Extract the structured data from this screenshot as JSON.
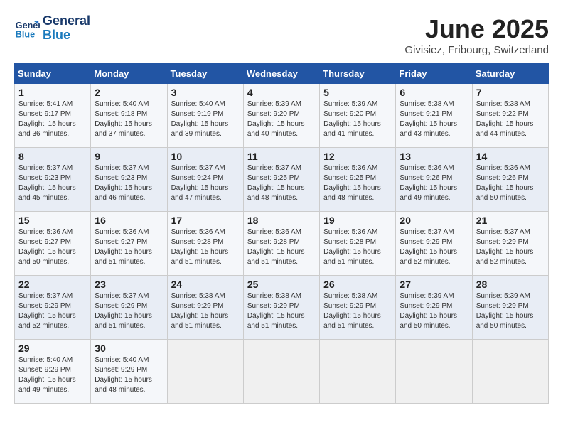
{
  "logo": {
    "line1": "General",
    "line2": "Blue"
  },
  "title": "June 2025",
  "subtitle": "Givisiez, Fribourg, Switzerland",
  "weekdays": [
    "Sunday",
    "Monday",
    "Tuesday",
    "Wednesday",
    "Thursday",
    "Friday",
    "Saturday"
  ],
  "weeks": [
    [
      {
        "day": "1",
        "info": "Sunrise: 5:41 AM\nSunset: 9:17 PM\nDaylight: 15 hours\nand 36 minutes."
      },
      {
        "day": "2",
        "info": "Sunrise: 5:40 AM\nSunset: 9:18 PM\nDaylight: 15 hours\nand 37 minutes."
      },
      {
        "day": "3",
        "info": "Sunrise: 5:40 AM\nSunset: 9:19 PM\nDaylight: 15 hours\nand 39 minutes."
      },
      {
        "day": "4",
        "info": "Sunrise: 5:39 AM\nSunset: 9:20 PM\nDaylight: 15 hours\nand 40 minutes."
      },
      {
        "day": "5",
        "info": "Sunrise: 5:39 AM\nSunset: 9:20 PM\nDaylight: 15 hours\nand 41 minutes."
      },
      {
        "day": "6",
        "info": "Sunrise: 5:38 AM\nSunset: 9:21 PM\nDaylight: 15 hours\nand 43 minutes."
      },
      {
        "day": "7",
        "info": "Sunrise: 5:38 AM\nSunset: 9:22 PM\nDaylight: 15 hours\nand 44 minutes."
      }
    ],
    [
      {
        "day": "8",
        "info": "Sunrise: 5:37 AM\nSunset: 9:23 PM\nDaylight: 15 hours\nand 45 minutes."
      },
      {
        "day": "9",
        "info": "Sunrise: 5:37 AM\nSunset: 9:23 PM\nDaylight: 15 hours\nand 46 minutes."
      },
      {
        "day": "10",
        "info": "Sunrise: 5:37 AM\nSunset: 9:24 PM\nDaylight: 15 hours\nand 47 minutes."
      },
      {
        "day": "11",
        "info": "Sunrise: 5:37 AM\nSunset: 9:25 PM\nDaylight: 15 hours\nand 48 minutes."
      },
      {
        "day": "12",
        "info": "Sunrise: 5:36 AM\nSunset: 9:25 PM\nDaylight: 15 hours\nand 48 minutes."
      },
      {
        "day": "13",
        "info": "Sunrise: 5:36 AM\nSunset: 9:26 PM\nDaylight: 15 hours\nand 49 minutes."
      },
      {
        "day": "14",
        "info": "Sunrise: 5:36 AM\nSunset: 9:26 PM\nDaylight: 15 hours\nand 50 minutes."
      }
    ],
    [
      {
        "day": "15",
        "info": "Sunrise: 5:36 AM\nSunset: 9:27 PM\nDaylight: 15 hours\nand 50 minutes."
      },
      {
        "day": "16",
        "info": "Sunrise: 5:36 AM\nSunset: 9:27 PM\nDaylight: 15 hours\nand 51 minutes."
      },
      {
        "day": "17",
        "info": "Sunrise: 5:36 AM\nSunset: 9:28 PM\nDaylight: 15 hours\nand 51 minutes."
      },
      {
        "day": "18",
        "info": "Sunrise: 5:36 AM\nSunset: 9:28 PM\nDaylight: 15 hours\nand 51 minutes."
      },
      {
        "day": "19",
        "info": "Sunrise: 5:36 AM\nSunset: 9:28 PM\nDaylight: 15 hours\nand 51 minutes."
      },
      {
        "day": "20",
        "info": "Sunrise: 5:37 AM\nSunset: 9:29 PM\nDaylight: 15 hours\nand 52 minutes."
      },
      {
        "day": "21",
        "info": "Sunrise: 5:37 AM\nSunset: 9:29 PM\nDaylight: 15 hours\nand 52 minutes."
      }
    ],
    [
      {
        "day": "22",
        "info": "Sunrise: 5:37 AM\nSunset: 9:29 PM\nDaylight: 15 hours\nand 52 minutes."
      },
      {
        "day": "23",
        "info": "Sunrise: 5:37 AM\nSunset: 9:29 PM\nDaylight: 15 hours\nand 51 minutes."
      },
      {
        "day": "24",
        "info": "Sunrise: 5:38 AM\nSunset: 9:29 PM\nDaylight: 15 hours\nand 51 minutes."
      },
      {
        "day": "25",
        "info": "Sunrise: 5:38 AM\nSunset: 9:29 PM\nDaylight: 15 hours\nand 51 minutes."
      },
      {
        "day": "26",
        "info": "Sunrise: 5:38 AM\nSunset: 9:29 PM\nDaylight: 15 hours\nand 51 minutes."
      },
      {
        "day": "27",
        "info": "Sunrise: 5:39 AM\nSunset: 9:29 PM\nDaylight: 15 hours\nand 50 minutes."
      },
      {
        "day": "28",
        "info": "Sunrise: 5:39 AM\nSunset: 9:29 PM\nDaylight: 15 hours\nand 50 minutes."
      }
    ],
    [
      {
        "day": "29",
        "info": "Sunrise: 5:40 AM\nSunset: 9:29 PM\nDaylight: 15 hours\nand 49 minutes."
      },
      {
        "day": "30",
        "info": "Sunrise: 5:40 AM\nSunset: 9:29 PM\nDaylight: 15 hours\nand 48 minutes."
      },
      null,
      null,
      null,
      null,
      null
    ]
  ]
}
